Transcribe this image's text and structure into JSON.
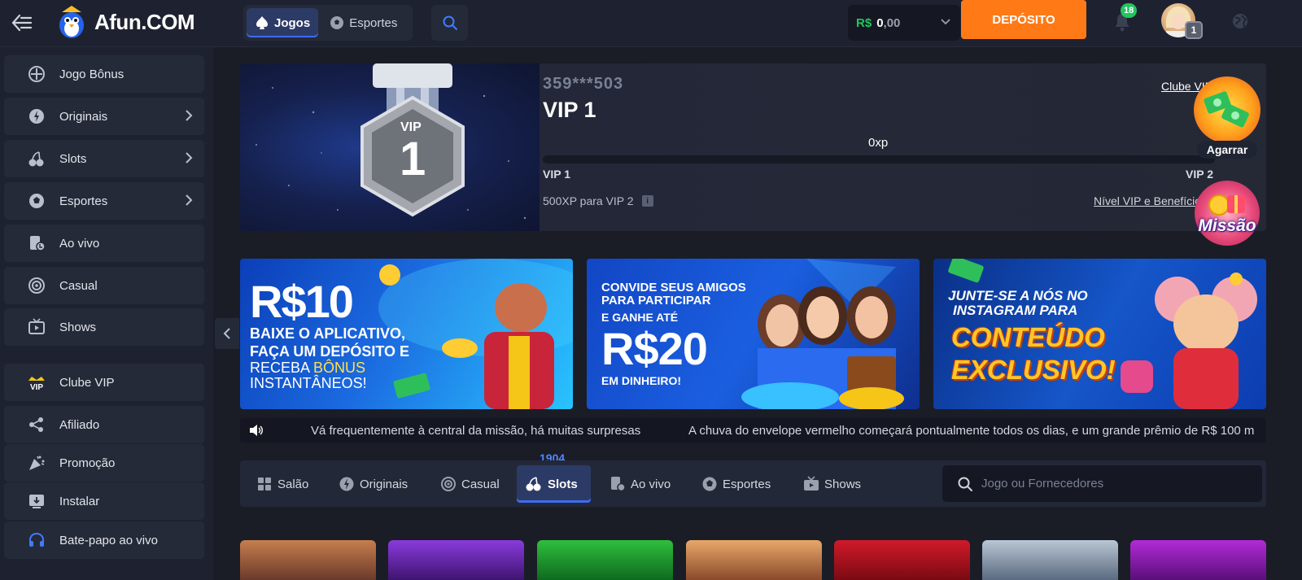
{
  "header": {
    "logo_text": "Afun.COM",
    "nav_jogos": "Jogos",
    "nav_esportes": "Esportes",
    "balance_currency": "R$",
    "balance_int": "0",
    "balance_dec": ",00",
    "deposit_label": "DEPÓSITO",
    "notifications_count": "18",
    "avatar_level": "1"
  },
  "sidebar": {
    "items": [
      {
        "label": "Jogo Bônus",
        "icon": "bonus-game-icon"
      },
      {
        "label": "Originais",
        "icon": "originals-icon",
        "has_arrow": true
      },
      {
        "label": "Slots",
        "icon": "cherry-icon",
        "has_arrow": true
      },
      {
        "label": "Esportes",
        "icon": "soccer-ball-icon",
        "has_arrow": true
      },
      {
        "label": "Ao vivo",
        "icon": "live-casino-icon"
      },
      {
        "label": "Casual",
        "icon": "casual-icon"
      },
      {
        "label": "Shows",
        "icon": "tv-icon"
      },
      {
        "label": "Clube VIP",
        "icon": "vip-crown-icon"
      },
      {
        "label": "Afiliado",
        "icon": "share-icon"
      },
      {
        "label": "Promoção",
        "icon": "party-popper-icon"
      },
      {
        "label": "Instalar",
        "icon": "download-icon"
      },
      {
        "label": "Bate-papo ao vivo",
        "icon": "headset-icon"
      }
    ]
  },
  "vip": {
    "user_id": "359***503",
    "level": "VIP 1",
    "medal_label": "VIP",
    "medal_number": "1",
    "xp": "0xp",
    "xp_progress": 0,
    "from_level": "VIP 1",
    "to_level": "VIP 2",
    "need_text": "500XP para VIP 2",
    "info_glyph": "i",
    "club_link": "Clube VIP",
    "benefits_link": "Nível VIP e Benefícios"
  },
  "floating": {
    "grab_label": "Agarrar",
    "mission_label": "Missão"
  },
  "banners": [
    {
      "big": "R$10",
      "line1": "BAIXE O APLICATIVO,",
      "line2": "FAÇA UM DEPÓSITO E",
      "line3a": "RECEBA ",
      "line3b": "BÔNUS",
      "line4": "INSTANTÂNEOS!"
    },
    {
      "line1": "CONVIDE SEUS AMIGOS",
      "line2": "PARA PARTICIPAR",
      "line3": "E GANHE ATÉ",
      "big": "R$20",
      "line4": "EM DINHEIRO!"
    },
    {
      "line1": "JUNTE-SE A NÓS NO",
      "line2": "INSTAGRAM PARA",
      "big1": "CONTEÚDO",
      "big2": "EXCLUSIVO!"
    }
  ],
  "marquee": {
    "text1": "Vá frequentemente à central da missão, há muitas surpresas",
    "text2": "A chuva do envelope vermelho começará pontualmente todos os dias, e um grande prêmio de R$ 100 m"
  },
  "tabs": {
    "slots_count": "1904",
    "items": [
      {
        "label": "Salão"
      },
      {
        "label": "Originais"
      },
      {
        "label": "Casual"
      },
      {
        "label": "Slots"
      },
      {
        "label": "Ao vivo"
      },
      {
        "label": "Esportes"
      },
      {
        "label": "Shows"
      }
    ],
    "search_placeholder": "Jogo ou Fornecedores"
  },
  "colors": {
    "accent_orange": "#ff7a16",
    "accent_green": "#22c55e",
    "accent_blue": "#3e6cf0",
    "panel": "#252a39"
  }
}
